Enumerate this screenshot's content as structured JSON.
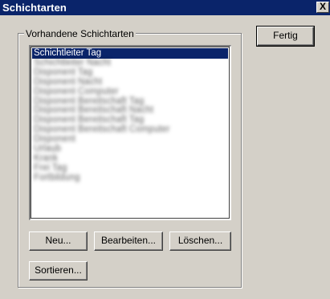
{
  "window": {
    "title": "Schichtarten",
    "close_label": "X"
  },
  "group": {
    "label": "Vorhandene Schichtarten"
  },
  "list": {
    "items": [
      {
        "label": "Schichtleiter Tag",
        "selected": true,
        "legible": true
      },
      {
        "label": "Schichtleiter Nacht",
        "selected": false,
        "legible": false
      },
      {
        "label": "Disponent Tag",
        "selected": false,
        "legible": false
      },
      {
        "label": "Disponent Nacht",
        "selected": false,
        "legible": false
      },
      {
        "label": "Disponent Computer",
        "selected": false,
        "legible": false
      },
      {
        "label": "Disponent Bereitschaft Tag",
        "selected": false,
        "legible": false
      },
      {
        "label": "Disponent Bereitschaft Nacht",
        "selected": false,
        "legible": false
      },
      {
        "label": "Disponent Bereitschaft Tag",
        "selected": false,
        "legible": false
      },
      {
        "label": "Disponent Bereitschaft Computer",
        "selected": false,
        "legible": false
      },
      {
        "label": "Disponent",
        "selected": false,
        "legible": false
      },
      {
        "label": "Urlaub",
        "selected": false,
        "legible": false
      },
      {
        "label": "Krank",
        "selected": false,
        "legible": false
      },
      {
        "label": "Frei Tag",
        "selected": false,
        "legible": false
      },
      {
        "label": "Fortbildung",
        "selected": false,
        "legible": false
      }
    ]
  },
  "buttons": {
    "done": "Fertig",
    "new": "Neu...",
    "edit": "Bearbeiten...",
    "delete": "Löschen...",
    "sort": "Sortieren..."
  }
}
